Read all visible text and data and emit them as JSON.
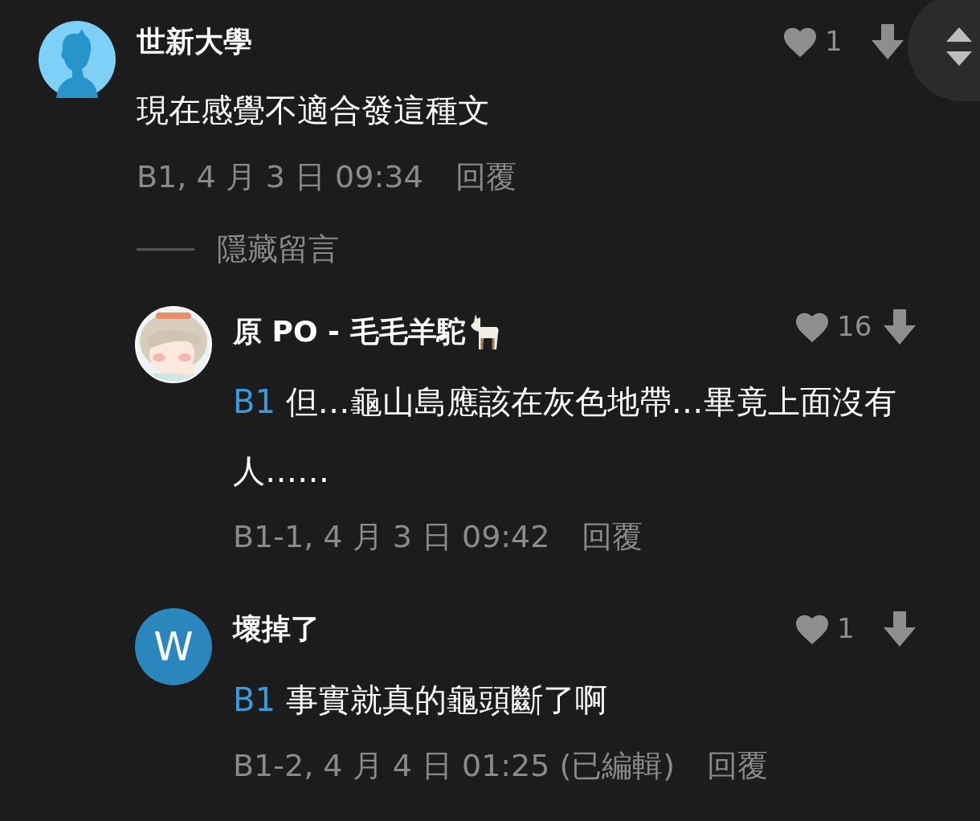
{
  "comment": {
    "author": "世新大學",
    "avatar": {
      "kind": "silhouette"
    },
    "likes": "1",
    "body": "現在感覺不適合發這種文",
    "meta": "B1, 4 月 3 日 09:34",
    "reply_label": "回覆"
  },
  "hide_replies": "隱藏留言",
  "replies": [
    {
      "author": "原 PO - 毛毛羊駝",
      "name_icon": true,
      "likes": "16",
      "tag": "B1",
      "body": "但…龜山島應該在灰色地帶…畢竟上面沒有人……",
      "meta": "B1-1, 4 月 3 日 09:42",
      "reply_label": "回覆"
    },
    {
      "author": "壞掉了",
      "name_icon": false,
      "avatar": {
        "kind": "letter",
        "letter": "W"
      },
      "likes": "1",
      "tag": "B1",
      "body": "事實就真的龜頭斷了啊",
      "meta": "B1-2, 4 月 4 日 01:25",
      "edited_note": "(已編輯)",
      "reply_label": "回覆"
    }
  ]
}
